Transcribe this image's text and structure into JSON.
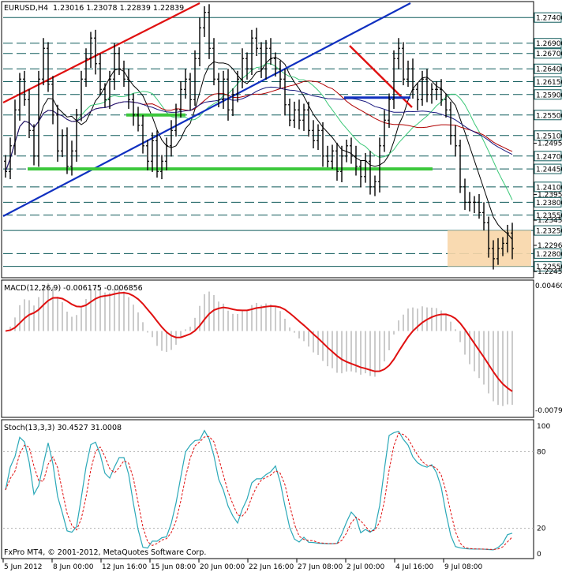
{
  "chart_data": [
    {
      "type": "candlestick",
      "header": {
        "symbol": "EURUSD,H4",
        "ohlc": "1.23016 1.23078 1.22839 1.22839"
      },
      "price_levels": [
        "1.27400",
        "1.26900",
        "1.26700",
        "1.26400",
        "1.26150",
        "1.25900",
        "1.25500",
        "1.25100",
        "1.24700",
        "1.24450",
        "1.24100",
        "1.23800",
        "1.23550",
        "1.23250",
        "1.22800",
        "1.22550"
      ],
      "axis_ticks": [
        "1.2495",
        "1.2395",
        "1.2345",
        "1.2296",
        "1.2245"
      ],
      "green_levels": [
        1.255,
        1.2445
      ],
      "blue_short_level": 1.259,
      "highlight_box": {
        "price_low": 1.2255,
        "price_high": 1.2325
      },
      "x_labels": [
        "5 Jun 2012",
        "8 Jun 00:00",
        "12 Jun 16:00",
        "15 Jun 08:00",
        "20 Jun 00:00",
        "22 Jun 16:00",
        "27 Jun 08:00",
        "2 Jul 00:00",
        "4 Jul 16:00",
        "9 Jul 08:00"
      ],
      "closes": [
        1.244,
        1.249,
        1.256,
        1.262,
        1.258,
        1.252,
        1.247,
        1.262,
        1.268,
        1.261,
        1.255,
        1.248,
        1.251,
        1.245,
        1.248,
        1.255,
        1.262,
        1.266,
        1.27,
        1.265,
        1.26,
        1.258,
        1.262,
        1.267,
        1.264,
        1.262,
        1.258,
        1.255,
        1.253,
        1.249,
        1.246,
        1.25,
        1.244,
        1.246,
        1.249,
        1.252,
        1.256,
        1.26,
        1.262,
        1.258,
        1.266,
        1.272,
        1.275,
        1.268,
        1.262,
        1.258,
        1.262,
        1.256,
        1.259,
        1.262,
        1.266,
        1.264,
        1.27,
        1.268,
        1.264,
        1.268,
        1.266,
        1.264,
        1.262,
        1.257,
        1.254,
        1.256,
        1.254,
        1.256,
        1.252,
        1.25,
        1.252,
        1.247,
        1.246,
        1.248,
        1.244,
        1.247,
        1.249,
        1.247,
        1.245,
        1.243,
        1.246,
        1.241,
        1.242,
        1.249,
        1.254,
        1.258,
        1.266,
        1.268,
        1.262,
        1.264,
        1.26,
        1.258,
        1.262,
        1.259,
        1.26,
        1.26,
        1.258,
        1.256,
        1.251,
        1.249,
        1.241,
        1.238,
        1.238,
        1.238,
        1.236,
        1.234,
        1.229,
        1.227,
        1.229,
        1.23,
        1.232,
        1.229
      ]
    },
    {
      "type": "line",
      "header": "MACD(12,26,9) -0.006175 -0.006856",
      "axis_ticks": [
        "0.004600",
        "-0.007940"
      ],
      "ylim": [
        -0.0079,
        0.0046
      ]
    },
    {
      "type": "line",
      "header": "Stoch(13,3,3) 30.4527 31.0008",
      "axis_ticks": [
        "100",
        "80",
        "20",
        "0"
      ],
      "ylim": [
        0,
        100
      ]
    }
  ],
  "copyright": "FxPro MT4, © 2001-2012, MetaQuotes Software Corp."
}
